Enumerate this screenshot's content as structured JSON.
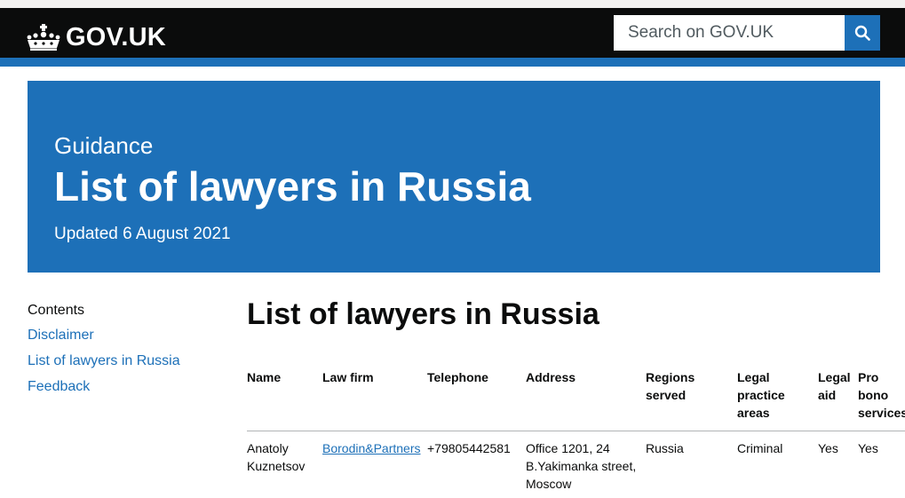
{
  "header": {
    "logo_text": "GOV.UK",
    "search_placeholder": "Search on GOV.UK",
    "colors": {
      "header_bg": "#0b0c0c",
      "brand_blue": "#1d70b8"
    }
  },
  "hero": {
    "caption": "Guidance",
    "title": "List of lawyers in Russia",
    "updated": "Updated 6 August 2021"
  },
  "contents": {
    "heading": "Contents",
    "links": [
      "Disclaimer",
      "List of lawyers in Russia",
      "Feedback"
    ]
  },
  "main": {
    "title": "List of lawyers in Russia",
    "table": {
      "headers": [
        "Name",
        "Law firm",
        "Telephone",
        "Address",
        "Regions served",
        "Legal practice areas",
        "Legal aid",
        "Pro bono services"
      ],
      "rows": [
        [
          "Anatoly Kuznetsov",
          "Borodin&Partners",
          "+79805442581",
          "Office 1201, 24 B.Yakimanka street, Moscow",
          "Russia",
          "Criminal",
          "Yes",
          "Yes"
        ]
      ]
    }
  }
}
